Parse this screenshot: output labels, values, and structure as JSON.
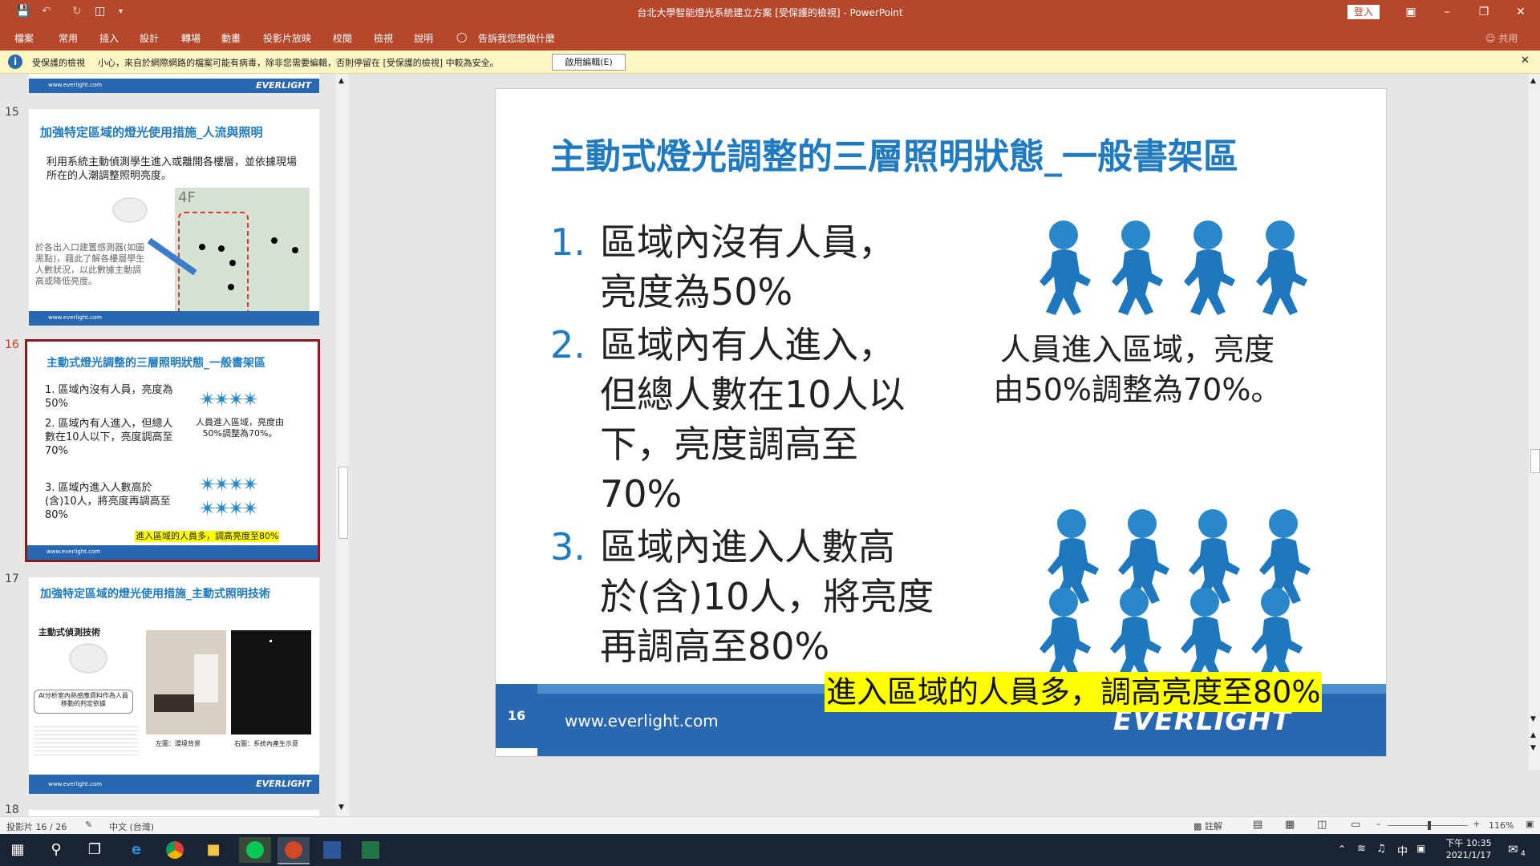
{
  "window": {
    "title": "台北大學智能燈光系統建立方案 [受保護的檢視] - PowerPoint",
    "signin_label": "登入",
    "share_label": "共用"
  },
  "menu": {
    "items": [
      "檔案",
      "常用",
      "插入",
      "設計",
      "轉場",
      "動畫",
      "投影片放映",
      "校閱",
      "檢視",
      "說明"
    ],
    "tell_me": "告訴我您想做什麼"
  },
  "protected_view": {
    "title": "受保護的檢視",
    "message": "小心，來自於網際網路的檔案可能有病毒，除非您需要編輯，否則停留在 [受保護的檢視] 中較為安全。",
    "enable_button": "啟用編輯(E)"
  },
  "thumbnails": {
    "prev_url": "www.everlight.com",
    "logo": "EVERLIGHT",
    "t15": {
      "num": "15",
      "title": "加強特定區域的燈光使用措施_人流與照明",
      "bullet": "利用系統主動偵測學生進入或離開各樓層，並依據現場所在的人潮調整照明亮度。",
      "side_text": "於各出入口建置感測器(如圖黑點)，藉此了解各樓層學生人數狀況，以此數據主動調高或降低亮度。",
      "map_label": "4F",
      "url": "www.everlight.com"
    },
    "t16": {
      "num": "16",
      "title": "主動式燈光調整的三層照明狀態_一般書架區",
      "items": [
        "1.  區域內沒有人員，亮度為50%",
        "2.  區域內有人進入，但總人數在10人以下，亮度調高至70%",
        "3.  區域內進入人數高於(含)10人，將亮度再調高至80%"
      ],
      "caption": "人員進入區域，亮度由50%調整為70%。",
      "highlight": "進入區域的人員多，調高亮度至80%",
      "url": "www.everlight.com"
    },
    "t17": {
      "num": "17",
      "title": "加強特定區域的燈光使用措施_主動式照明技術",
      "subtitle": "主動式偵測技術",
      "box_text": "AI分析室內熱感應資料作為人員移動的判定依據",
      "left_caption": "左圖：環境背景",
      "right_caption": "右圖：系統內產生示意",
      "url": "www.everlight.com"
    },
    "t18": {
      "num": "18"
    }
  },
  "slide": {
    "title": "主動式燈光調整的三層照明狀態_一般書架區",
    "items": [
      {
        "num": "1.",
        "lines": [
          "區域內沒有人員，",
          "亮度為50%"
        ]
      },
      {
        "num": "2.",
        "lines": [
          "區域內有人進入，",
          "但總人數在10人以",
          "下，亮度調高至",
          "70%"
        ]
      },
      {
        "num": "3.",
        "lines": [
          "區域內進入人數高",
          "於(含)10人，將亮度",
          "再調高至80%"
        ]
      }
    ],
    "caption_line1": "人員進入區域，亮度",
    "caption_line2": "由50%調整為70%。",
    "highlight": "進入區域的人員多，調高亮度至80%",
    "page_number": "16",
    "footer_url": "www.everlight.com",
    "footer_logo": "EVERLIGHT",
    "colors": {
      "accent": "#1f7ac0",
      "footer": "#2a67b1",
      "highlight": "#ffff00"
    }
  },
  "status": {
    "slide_info": "投影片 16 / 26",
    "language": "中文 (台灣)",
    "notes_label": "註解",
    "zoom": "116%"
  },
  "taskbar": {
    "time": "下午 10:35",
    "date": "2021/1/17",
    "ime": "中",
    "notif_count": "4"
  }
}
